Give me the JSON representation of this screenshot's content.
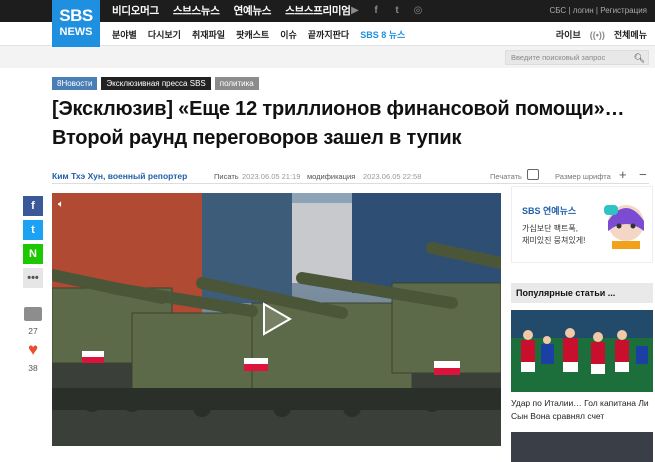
{
  "logo": {
    "line1": "SBS",
    "line2": "NEWS"
  },
  "brand_nav": [
    "비디오머그",
    "스브스뉴스",
    "연예뉴스",
    "스브스프리미엄"
  ],
  "social_icons": [
    "youtube-icon",
    "facebook-icon",
    "twitter-icon",
    "instagram-icon"
  ],
  "util_links": {
    "text": "СБС | логин | Регистрация"
  },
  "subnav": {
    "items": [
      "분야별",
      "다시보기",
      "취재파일",
      "팟캐스트",
      "이슈",
      "끝까지판다",
      "SBS 8 뉴스"
    ],
    "right": {
      "live": "라이브",
      "live_icon": "((•))",
      "all_menu": "전체메뉴"
    }
  },
  "search": {
    "placeholder": "Введите поисковый запрос"
  },
  "tags": [
    "8Новости",
    "Эксклюзивная пресса SBS",
    "политика"
  ],
  "headline": "[Эксклюзив] «Еще 12 триллионов финансовой помощи»… Второй раунд переговоров зашел в тупик",
  "byline": {
    "author": "Ким Тхэ Хун, военный репортер",
    "write_label": "Писать",
    "write_date": "2023.06.05 21:19",
    "mod_label": "модификация",
    "mod_date": "2023.06.05 22:58",
    "print_label": "Печатать",
    "font_label": "Размер шрифта",
    "plus": "+",
    "minus": "−"
  },
  "share": {
    "facebook": "f",
    "twitter": "t",
    "naver": "N",
    "more": "•••"
  },
  "reactions": {
    "comments": "27",
    "likes": "38"
  },
  "ad": {
    "brand": "SBS 연예뉴스",
    "line1": "가십보단 팩트폭,",
    "line2": "재미있진 뭉쳐있게!"
  },
  "popular": {
    "title": "Популярные статьи ...",
    "story1": "Удар по Италии… Гол капитана Ли Сын Вона сравнял счет"
  },
  "colors": {
    "accent": "#1f8fe0",
    "author": "#1f5fa8",
    "topbar": "#1d1d1d"
  }
}
